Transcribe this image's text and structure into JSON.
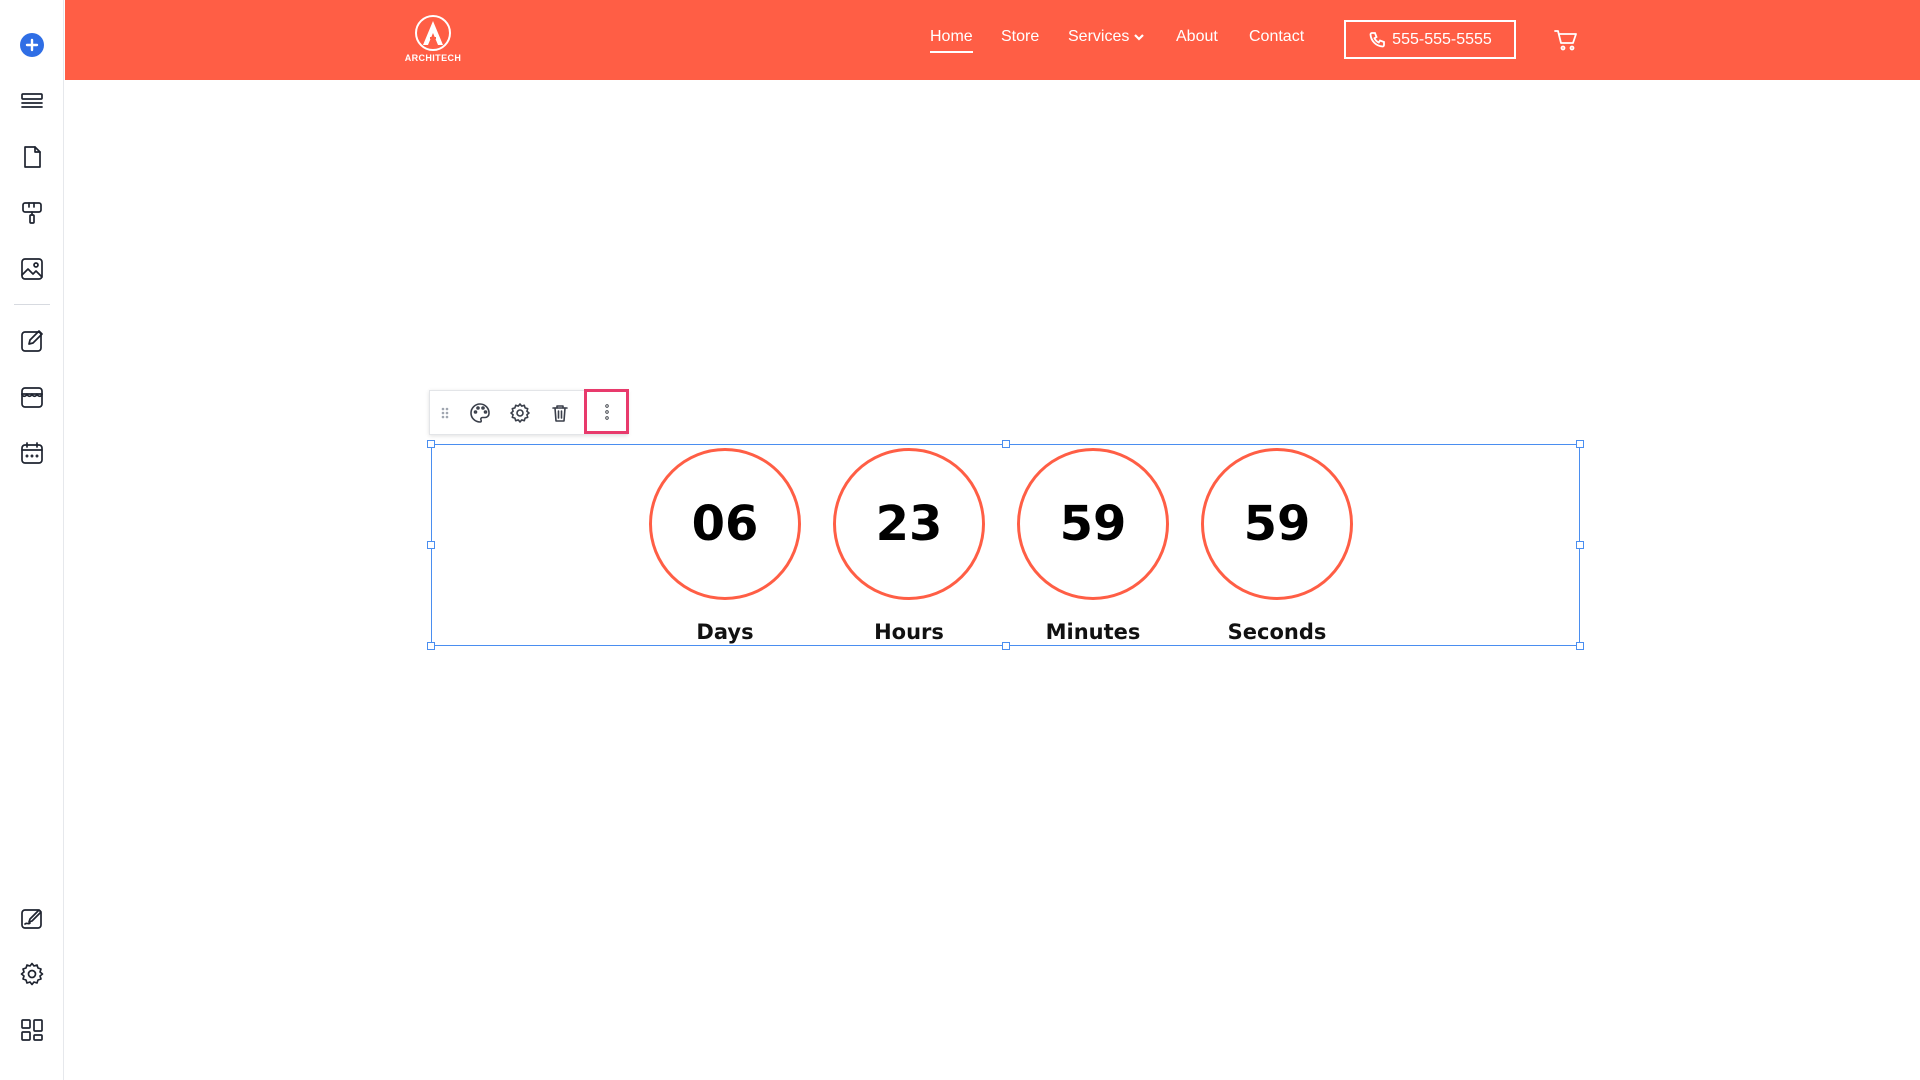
{
  "sidebar": {
    "items": [
      {
        "icon": "plus-icon"
      },
      {
        "icon": "layers-icon"
      },
      {
        "icon": "page-icon"
      },
      {
        "icon": "paint-roller-icon"
      },
      {
        "icon": "image-icon"
      },
      {
        "icon": "edit-icon"
      },
      {
        "icon": "store-icon"
      },
      {
        "icon": "calendar-icon"
      },
      {
        "icon": "signature-icon"
      },
      {
        "icon": "gear-icon"
      },
      {
        "icon": "dashboard-icon"
      }
    ],
    "accent": "#2f6ee5"
  },
  "header": {
    "logo_text": "ARCHITECH",
    "nav": [
      "Home",
      "Store",
      "Services",
      "About",
      "Contact"
    ],
    "active": "Home",
    "phone": "555-555-5555",
    "brand_color": "#ff5e45"
  },
  "toolbar": {
    "icons": [
      "drag-handle-icon",
      "palette-icon",
      "gear-icon",
      "trash-icon",
      "more-vertical-icon"
    ],
    "highlight_color": "#e83a6c"
  },
  "countdown": {
    "items": [
      {
        "value": "06",
        "label": "Days"
      },
      {
        "value": "23",
        "label": "Hours"
      },
      {
        "value": "59",
        "label": "Minutes"
      },
      {
        "value": "59",
        "label": "Seconds"
      }
    ],
    "ring_color": "#ff5e45"
  },
  "selection_color": "#4a8ef0"
}
